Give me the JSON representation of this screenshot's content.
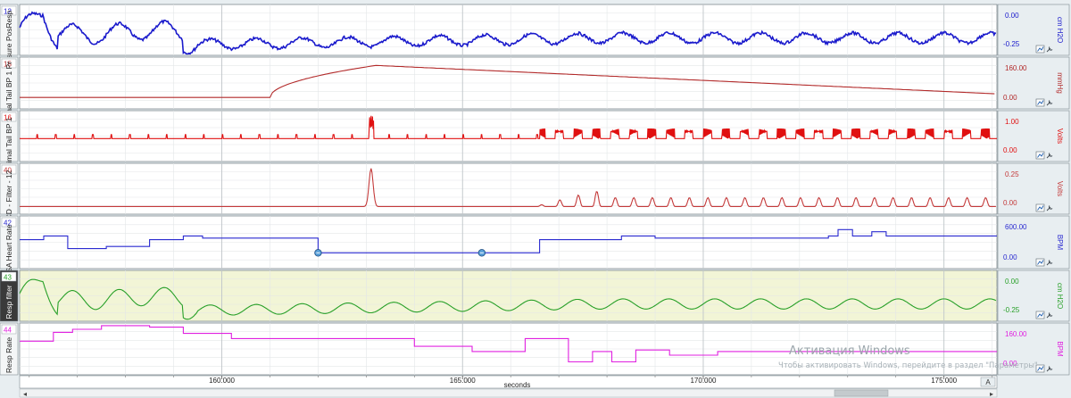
{
  "axis": {
    "x_range": [
      155.8,
      176.1
    ],
    "ticks": [
      {
        "value": 160,
        "label": "160.000"
      },
      {
        "value": 165,
        "label": "165.000"
      },
      {
        "value": 170,
        "label": "170.000"
      },
      {
        "value": 175,
        "label": "175.000"
      }
    ],
    "label": "seconds",
    "zoom_button": "A",
    "scroll_left": "◂",
    "scroll_right": "▸"
  },
  "channels": [
    {
      "id": "pressure",
      "number": "12",
      "name": "ssure PosResp",
      "unit": "cm H2O",
      "y_top": "0.00",
      "y_bottom": "-0.25",
      "color": "#1a1acc",
      "number_color": "#1a1acc",
      "highlight": false
    },
    {
      "id": "tail_bp",
      "number": "15",
      "name": "imal Tail BP 1 Pr",
      "unit": "mmHg",
      "y_top": "160.00",
      "y_bottom": "0.00",
      "color": "#b22a2a",
      "number_color": "#b22a2a",
      "highlight": false
    },
    {
      "id": "tail_bp_raw",
      "number": "16",
      "name": "nimal Tail BP 1",
      "unit": "Volts",
      "y_top": "1.00",
      "y_bottom": "0.00",
      "color": "#e01010",
      "number_color": "#e01010",
      "highlight": false
    },
    {
      "id": "cd_filter",
      "number": "40",
      "name": "CD - Filter - 12",
      "unit": "Volts",
      "y_top": "0.25",
      "y_bottom": "0.00",
      "color": "#c43a3a",
      "number_color": "#c43a3a",
      "highlight": false
    },
    {
      "id": "heart_rate",
      "number": "42",
      "name": "SA Heart Rate",
      "unit": "BPM",
      "y_top": "600.00",
      "y_bottom": "0.00",
      "color": "#2a2ad0",
      "number_color": "#2a2ad0",
      "highlight": false
    },
    {
      "id": "resp_filter",
      "number": "43",
      "name": "Resp filter",
      "unit": "cm H2O",
      "y_top": "0.00",
      "y_bottom": "-0.25",
      "color": "#28a028",
      "number_color": "#28a028",
      "highlight": true
    },
    {
      "id": "resp_rate",
      "number": "44",
      "name": "Resp Rate",
      "unit": "BPM",
      "y_top": "160.00",
      "y_bottom": "0.00",
      "color": "#e020e0",
      "number_color": "#e020e0",
      "highlight": false
    }
  ],
  "markers": [
    {
      "channel": "heart_rate",
      "time": 162.0
    },
    {
      "channel": "heart_rate",
      "time": 165.4
    }
  ],
  "watermark": {
    "title": "Активация Windows",
    "subtitle": "Чтобы активировать Windows, перейдите в раздел \"Параметры\"."
  },
  "colors": {
    "panel_bg": "#ffffff",
    "highlight_bg": "#f2f5d6",
    "grid": "#cfd4d8",
    "frame": "#7f8a90",
    "side_bg": "#e8eef1"
  },
  "icons": [
    "zoom-fit-icon",
    "wrench-icon"
  ]
}
